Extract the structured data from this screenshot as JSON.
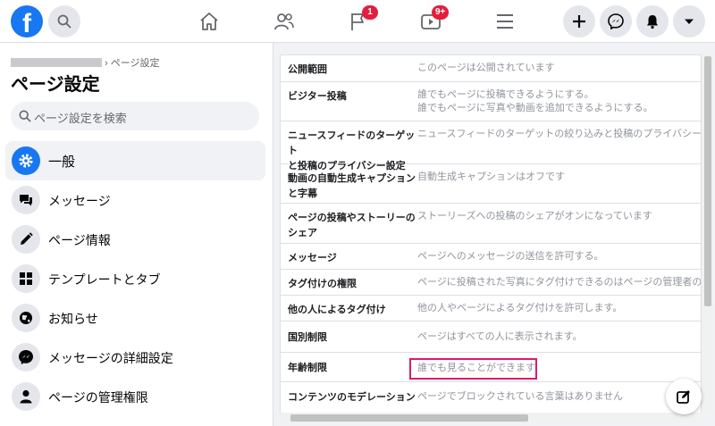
{
  "header": {
    "logo_letter": "f",
    "nav": [
      {
        "name": "home",
        "badge": ""
      },
      {
        "name": "friends",
        "badge": ""
      },
      {
        "name": "pages",
        "badge": "1"
      },
      {
        "name": "watch",
        "badge": "9+"
      },
      {
        "name": "menu",
        "badge": ""
      }
    ],
    "actions": [
      "plus-icon",
      "messenger-icon",
      "notifications-icon",
      "dropdown-icon"
    ]
  },
  "sidebar": {
    "breadcrumb": "› ページ設定",
    "title": "ページ設定",
    "search_placeholder": "ページ設定を検索",
    "items": [
      {
        "label": "一般",
        "icon": "gear-icon",
        "active": true
      },
      {
        "label": "メッセージ",
        "icon": "chat-icon",
        "active": false
      },
      {
        "label": "ページ情報",
        "icon": "pencil-icon",
        "active": false
      },
      {
        "label": "テンプレートとタブ",
        "icon": "grid-icon",
        "active": false
      },
      {
        "label": "お知らせ",
        "icon": "globe-icon",
        "active": false
      },
      {
        "label": "メッセージの詳細設定",
        "icon": "messenger-icon",
        "active": false
      },
      {
        "label": "ページの管理権限",
        "icon": "person-icon",
        "active": false
      }
    ]
  },
  "settings": {
    "rows": [
      {
        "label": "公開範囲",
        "value": "このページは公開されています"
      },
      {
        "label": "ビジター投稿",
        "value": "誰でもページに投稿できるようにする。\n誰でもページに写真や動画を追加できるようにする。"
      },
      {
        "label": "ニュースフィードのターゲット\nと投稿のプライバシー設定",
        "value": "ニュースフィードのターゲットの絞り込みと投稿のプライバシー設定に"
      },
      {
        "label": "動画の自動生成キャプション\nと字幕",
        "value": "自動生成キャプションはオフです"
      },
      {
        "label": "ページの投稿やストーリーの\nシェア",
        "value": "ストーリーズへの投稿のシェアがオンになっています"
      },
      {
        "label": "メッセージ",
        "value": "ページへのメッセージの送信を許可する。"
      },
      {
        "label": "タグ付けの権限",
        "value": "ページに投稿された写真にタグ付けできるのはページの管理者のみで"
      },
      {
        "label": "他の人によるタグ付け",
        "value": "他の人やページによるタグ付けを許可します。"
      },
      {
        "label": "国別制限",
        "value": "ページはすべての人に表示されます。"
      },
      {
        "label": "年齢制限",
        "value": "誰でも見ることができます"
      },
      {
        "label": "コンテンツのモデレーション",
        "value": "ページでブロックされている言葉はありません"
      }
    ]
  },
  "colors": {
    "brand": "#1877f2",
    "badge": "#e41e3f",
    "highlight": "#e2166e"
  }
}
